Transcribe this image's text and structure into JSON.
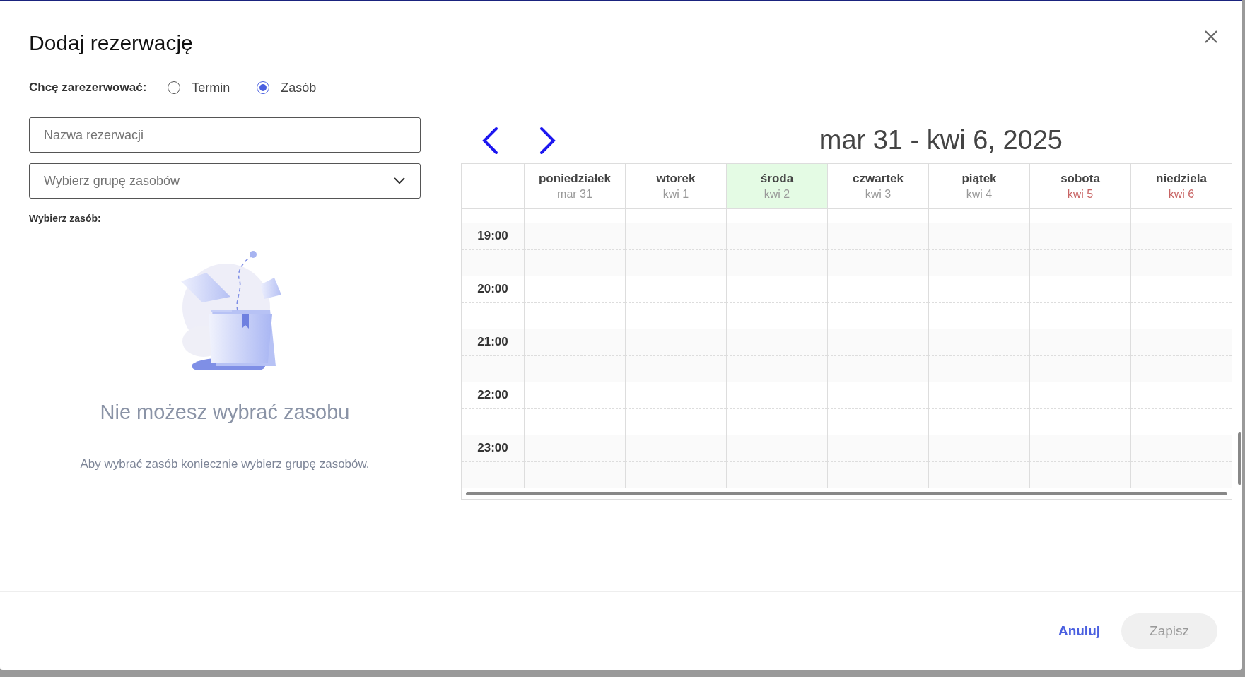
{
  "dialog": {
    "title": "Dodaj rezerwację"
  },
  "booking_type": {
    "label": "Chcę zarezerwować:",
    "options": [
      {
        "label": "Termin",
        "selected": false
      },
      {
        "label": "Zasób",
        "selected": true
      }
    ]
  },
  "name_field": {
    "placeholder": "Nazwa rezerwacji"
  },
  "group_select": {
    "placeholder": "Wybierz grupę zasobów"
  },
  "resource": {
    "label": "Wybierz zasób:",
    "empty_title": "Nie możesz wybrać zasobu",
    "empty_text": "Aby wybrać zasób koniecznie wybierz grupę zasobów."
  },
  "calendar": {
    "range": "mar 31 - kwi 6, 2025",
    "days": [
      {
        "name": "poniedziałek",
        "date": "mar 31",
        "today": false,
        "weekend": false
      },
      {
        "name": "wtorek",
        "date": "kwi 1",
        "today": false,
        "weekend": false
      },
      {
        "name": "środa",
        "date": "kwi 2",
        "today": true,
        "weekend": false
      },
      {
        "name": "czwartek",
        "date": "kwi 3",
        "today": false,
        "weekend": false
      },
      {
        "name": "piątek",
        "date": "kwi 4",
        "today": false,
        "weekend": false
      },
      {
        "name": "sobota",
        "date": "kwi 5",
        "today": false,
        "weekend": true
      },
      {
        "name": "niedziela",
        "date": "kwi 6",
        "today": false,
        "weekend": true
      }
    ],
    "times": [
      "19:00",
      "20:00",
      "21:00",
      "22:00",
      "23:00"
    ]
  },
  "footer": {
    "buttons": [
      {
        "label": "Anuluj",
        "kind": "text",
        "disabled": false
      },
      {
        "label": "Zapisz",
        "kind": "filled",
        "disabled": true
      }
    ]
  }
}
